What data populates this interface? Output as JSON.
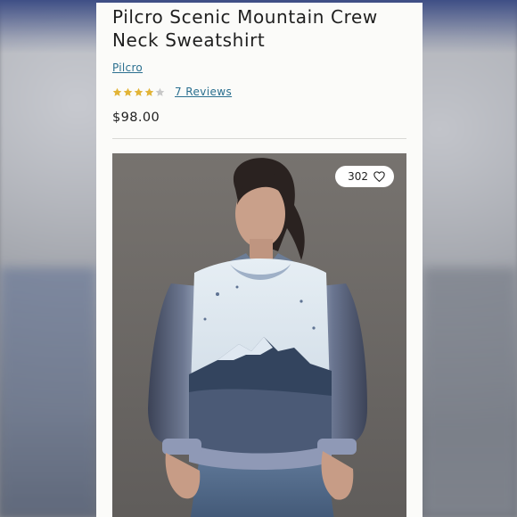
{
  "product": {
    "title_line1": "Pilcro Scenic Mountain Crew",
    "title_line2": "Neck Sweatshirt",
    "brand": "Pilcro",
    "rating": 4,
    "rating_max": 5,
    "reviews_label": "7 Reviews",
    "price": "$98.00"
  },
  "image": {
    "likes_count": "302",
    "like_icon": "heart-icon"
  },
  "colors": {
    "link": "#2a6f8f",
    "star_filled": "#e2b437",
    "star_empty": "#c8c8c8",
    "accent_bar": "#3f4f86"
  }
}
